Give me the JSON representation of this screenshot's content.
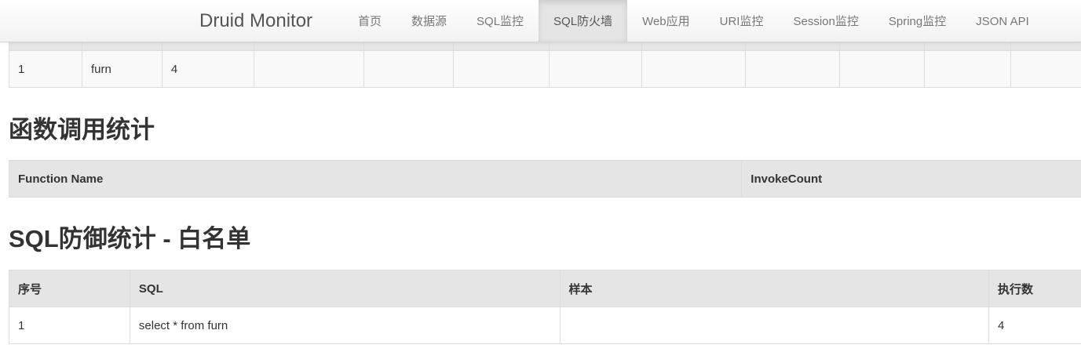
{
  "navbar": {
    "brand": "Druid Monitor",
    "items": [
      {
        "label": "首页",
        "active": false
      },
      {
        "label": "数据源",
        "active": false
      },
      {
        "label": "SQL监控",
        "active": false
      },
      {
        "label": "SQL防火墙",
        "active": true
      },
      {
        "label": "Web应用",
        "active": false
      },
      {
        "label": "URI监控",
        "active": false
      },
      {
        "label": "Session监控",
        "active": false
      },
      {
        "label": "Spring监控",
        "active": false
      },
      {
        "label": "JSON API",
        "active": false
      }
    ]
  },
  "table_stats": {
    "row": [
      "1",
      "furn",
      "4",
      "",
      "",
      "",
      "",
      "",
      "",
      "",
      "",
      ""
    ]
  },
  "function_stats": {
    "title": "函数调用统计",
    "columns": [
      "Function Name",
      "InvokeCount"
    ]
  },
  "whitelist": {
    "title": "SQL防御统计 - 白名单",
    "columns": [
      "序号",
      "SQL",
      "样本",
      "执行数"
    ],
    "rows": [
      [
        "1",
        "select * from furn",
        "",
        "4"
      ]
    ]
  },
  "colors": {
    "header_bg": "#e5e5e5",
    "border": "#dddddd",
    "text": "#333333",
    "nav_text": "#777777"
  }
}
